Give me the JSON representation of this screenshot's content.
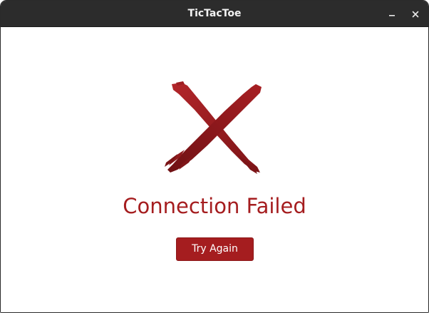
{
  "window": {
    "title": "TicTacToe",
    "controls": {
      "minimize_icon": "minimize-icon",
      "close_icon": "close-icon"
    }
  },
  "main": {
    "status_icon": "x-mark-icon",
    "message": "Connection Failed",
    "retry_button_label": "Try Again"
  },
  "colors": {
    "accent": "#a51d1f",
    "titlebar": "#2c2c2c",
    "background": "#ffffff"
  }
}
